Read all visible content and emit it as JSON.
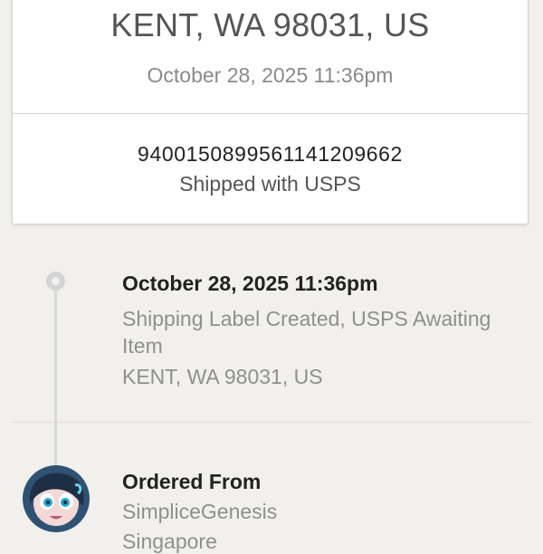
{
  "shipment_card": {
    "location": "KENT, WA 98031, US",
    "datetime": "October 28, 2025 11:36pm",
    "tracking_number": "9400150899561141209662",
    "carrier_text": "Shipped with USPS"
  },
  "timeline": {
    "event": {
      "datetime": "October 28, 2025 11:36pm",
      "status": "Shipping Label Created, USPS Awaiting Item",
      "location": "KENT, WA 98031, US"
    }
  },
  "ordered_from": {
    "heading": "Ordered From",
    "shop_name": "SimpliceGenesis",
    "shop_location": "Singapore"
  },
  "colors": {
    "background": "#f1f0ec",
    "card": "#ffffff",
    "primary_text": "#222222",
    "secondary_text": "#8f8f8f",
    "timeline": "#d9d9d9"
  },
  "icons": {
    "timeline_marker": "timeline-dot-icon",
    "shop_avatar": "shop-avatar"
  }
}
